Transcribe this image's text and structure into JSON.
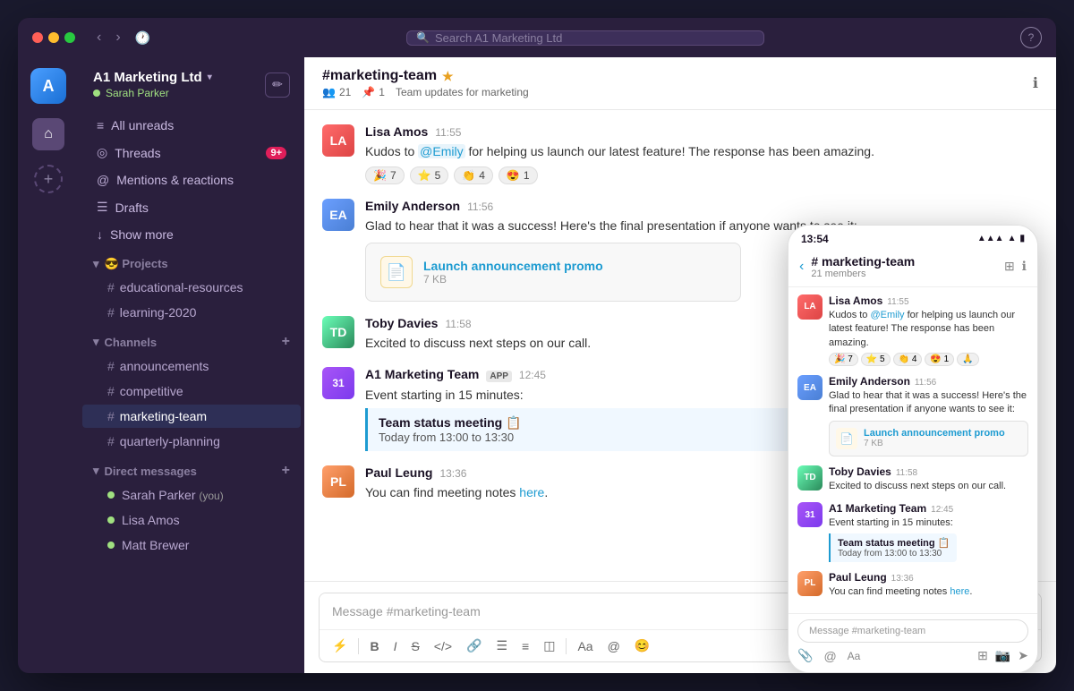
{
  "titlebar": {
    "search_placeholder": "Search A1 Marketing Ltd",
    "help_label": "?"
  },
  "workspace": {
    "name": "A1 Marketing Ltd",
    "chevron": "▾",
    "user": "Sarah Parker",
    "status": "online"
  },
  "sidebar": {
    "nav_items": [
      {
        "id": "all-unreads",
        "icon": "≡",
        "label": "All unreads",
        "badge": null
      },
      {
        "id": "threads",
        "icon": "◎",
        "label": "Threads",
        "badge": "9+"
      },
      {
        "id": "mentions",
        "icon": "◎",
        "label": "Mentions & reactions",
        "badge": null
      },
      {
        "id": "drafts",
        "icon": "☰",
        "label": "Drafts",
        "badge": null
      },
      {
        "id": "show-more",
        "icon": "↓",
        "label": "Show more",
        "badge": null
      }
    ],
    "projects_section": "😎 Projects",
    "project_channels": [
      {
        "name": "educational-resources"
      },
      {
        "name": "learning-2020"
      }
    ],
    "channels_section": "Channels",
    "channels": [
      {
        "name": "announcements",
        "active": false
      },
      {
        "name": "competitive",
        "active": false
      },
      {
        "name": "marketing-team",
        "active": true
      },
      {
        "name": "quarterly-planning",
        "active": false
      }
    ],
    "dm_section": "Direct messages",
    "dms": [
      {
        "name": "Sarah Parker",
        "suffix": "(you)",
        "online": true
      },
      {
        "name": "Lisa Amos",
        "suffix": "",
        "online": true
      },
      {
        "name": "Matt Brewer",
        "suffix": "",
        "online": true
      }
    ]
  },
  "chat": {
    "channel_name": "#marketing-team",
    "channel_star": "★",
    "meta_members": "21",
    "meta_pins": "1",
    "meta_description": "Team updates for marketing",
    "messages": [
      {
        "id": "msg1",
        "sender": "Lisa Amos",
        "timestamp": "11:55",
        "avatar_initials": "LA",
        "avatar_class": "avatar-lisa",
        "text": "Kudos to @Emily for helping us launch our latest feature! The response has been amazing.",
        "mention": "@Emily",
        "reactions": [
          {
            "emoji": "🎉",
            "count": "7"
          },
          {
            "emoji": "⭐",
            "count": "5"
          },
          {
            "emoji": "👏",
            "count": "4"
          },
          {
            "emoji": "😍",
            "count": "1"
          }
        ]
      },
      {
        "id": "msg2",
        "sender": "Emily Anderson",
        "timestamp": "11:56",
        "avatar_initials": "EA",
        "avatar_class": "avatar-emily",
        "text": "Glad to hear that it was a success! Here's the final presentation if anyone wants to see it:",
        "file": {
          "name": "Launch announcement promo",
          "size": "7 KB",
          "icon": "📄"
        }
      },
      {
        "id": "msg3",
        "sender": "Toby Davies",
        "timestamp": "11:58",
        "avatar_initials": "TD",
        "avatar_class": "avatar-toby",
        "text": "Excited to discuss next steps on our call."
      },
      {
        "id": "msg4",
        "sender": "A1 Marketing Team",
        "timestamp": "12:45",
        "avatar_initials": "31",
        "avatar_class": "avatar-a1",
        "app_badge": "APP",
        "text": "Event starting in 15 minutes:",
        "event": {
          "title": "Team status meeting 📋",
          "time": "Today from 13:00 to 13:30"
        }
      },
      {
        "id": "msg5",
        "sender": "Paul Leung",
        "timestamp": "13:36",
        "avatar_initials": "PL",
        "avatar_class": "avatar-paul",
        "text": "You can find meeting notes here.",
        "link_text": "here"
      }
    ],
    "input_placeholder": "Message #marketing-team",
    "toolbar_buttons": [
      "⚡",
      "B",
      "I",
      "S̶",
      "</>",
      "🔗",
      "☰",
      "☰",
      "◫",
      "Aa",
      "@",
      "😊"
    ]
  },
  "mobile": {
    "status_time": "13:54",
    "channel_name": "# marketing-team",
    "members_label": "21 members",
    "messages": [
      {
        "sender": "Lisa Amos",
        "time": "11:55",
        "avatar_class": "avatar-lisa",
        "avatar_initials": "LA",
        "text": "Kudos to @Emily for helping us launch our latest feature! The response has been amazing.",
        "reactions": [
          "🎉 7",
          "⭐ 5",
          "👏 4",
          "😍 1",
          "🙏"
        ]
      },
      {
        "sender": "Emily Anderson",
        "time": "11:56",
        "avatar_class": "avatar-emily",
        "avatar_initials": "EA",
        "text": "Glad to hear that it was a success! Here's the final presentation if anyone wants to see it:",
        "file": {
          "name": "Launch announcement promo",
          "size": "7 KB"
        }
      },
      {
        "sender": "Toby Davies",
        "time": "11:58",
        "avatar_class": "avatar-toby",
        "avatar_initials": "TD",
        "text": "Excited to discuss next steps on our call."
      },
      {
        "sender": "A1 Marketing Team",
        "time": "12:45",
        "avatar_class": "avatar-a1",
        "avatar_initials": "31",
        "text": "Event starting in 15 minutes:",
        "event": {
          "title": "Team status meeting 📋",
          "time": "Today from 13:00 to 13:30"
        }
      },
      {
        "sender": "Paul Leung",
        "time": "13:36",
        "avatar_class": "avatar-paul",
        "avatar_initials": "PL",
        "text": "You can find meeting notes here."
      }
    ],
    "input_placeholder": "Message #marketing-team"
  }
}
